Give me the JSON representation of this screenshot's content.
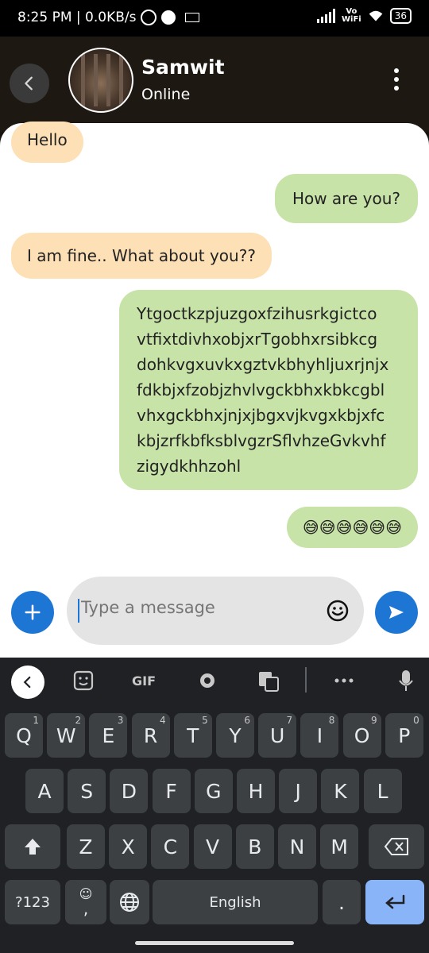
{
  "status_bar": {
    "time_speed": "8:25 PM | 0.0KB/s",
    "network_label_top": "Vo",
    "network_label_bottom": "WiFi",
    "battery": "36"
  },
  "header": {
    "contact_name": "Samwit",
    "contact_status": "Online",
    "back_icon": "chevron-left-icon",
    "menu_icon": "more-vertical-icon"
  },
  "messages": [
    {
      "type": "received",
      "text": "Hello"
    },
    {
      "type": "sent",
      "text": "How are you?"
    },
    {
      "type": "received",
      "text": "I am fine.. What about you??"
    },
    {
      "type": "sent",
      "lines": [
        "Ytgoctkzpjuzgoxfzihusrkgictco",
        "vtfixtdivhxobjxrTgobhxrsibkcg",
        "dohkvgxuvkxgztvkbhyhljuxrjnjx",
        "fdkbjxfzobjzhvlvgckbhxkbkcgbl",
        "vhxgckbhxjnjxjbgxvjkvgxkbjxfc",
        "kbjzrfkbfksblvgzrSflvhzeGvkvhf",
        "zigydkhhzohl"
      ]
    },
    {
      "type": "sent",
      "text": "😅😅😅😅😅😅"
    }
  ],
  "input": {
    "placeholder": "Type a message",
    "value": ""
  },
  "colors": {
    "received_bubble": "#fde0b5",
    "sent_bubble": "#c8e3a8",
    "accent": "#1e76d4",
    "keyboard_bg": "#202124"
  },
  "keyboard": {
    "toolbar": {
      "gif_label": "GIF",
      "icons": [
        "chevron-left-icon",
        "sticker-icon",
        "gear-icon",
        "translate-icon",
        "more-horizontal-icon",
        "mic-icon"
      ]
    },
    "row1": [
      {
        "k": "Q",
        "h": "1"
      },
      {
        "k": "W",
        "h": "2"
      },
      {
        "k": "E",
        "h": "3"
      },
      {
        "k": "R",
        "h": "4"
      },
      {
        "k": "T",
        "h": "5"
      },
      {
        "k": "Y",
        "h": "6"
      },
      {
        "k": "U",
        "h": "7"
      },
      {
        "k": "I",
        "h": "8"
      },
      {
        "k": "O",
        "h": "9"
      },
      {
        "k": "P",
        "h": "0"
      }
    ],
    "row2": [
      "A",
      "S",
      "D",
      "F",
      "G",
      "H",
      "J",
      "K",
      "L"
    ],
    "row3": [
      "Z",
      "X",
      "C",
      "V",
      "B",
      "N",
      "M"
    ],
    "symbols_label": "?123",
    "comma_label": ",",
    "space_label": "English",
    "period_label": "."
  }
}
